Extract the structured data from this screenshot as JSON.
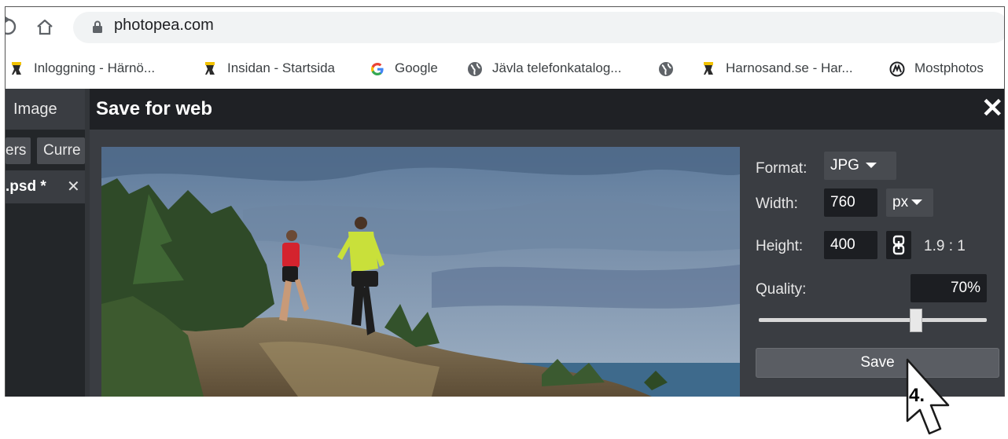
{
  "browser": {
    "url": "photopea.com",
    "bookmarks": [
      {
        "label": "Inloggning - Härnö...",
        "icon": "harnosand-logo-icon"
      },
      {
        "label": "Insidan - Startsida",
        "icon": "harnosand-logo-icon"
      },
      {
        "label": "Google",
        "icon": "google-icon"
      },
      {
        "label": "Jävla telefonkatalog...",
        "icon": "globe-icon"
      },
      {
        "label": "",
        "icon": "globe-icon"
      },
      {
        "label": "Harnosand.se - Har...",
        "icon": "harnosand-logo-icon"
      },
      {
        "label": "Mostphotos",
        "icon": "mostphotos-icon"
      }
    ]
  },
  "app": {
    "menu_image": "Image",
    "panel_buttons": [
      "ers",
      "Curre"
    ],
    "doc_tab": ".psd *",
    "doc_close": "✕"
  },
  "dialog": {
    "title": "Save for web",
    "close": "✕",
    "format_label": "Format:",
    "format_value": "JPG",
    "width_label": "Width:",
    "width_value": "760",
    "unit_value": "px",
    "height_label": "Height:",
    "height_value": "400",
    "ratio": "1.9 : 1",
    "quality_label": "Quality:",
    "quality_value": "70%",
    "quality_slider_fraction": 0.7,
    "save_label": "Save"
  },
  "annotation": {
    "step": "4."
  },
  "colors": {
    "dialog_bg": "#3a3d42",
    "titlebar_bg": "#1f2125",
    "field_bg": "#1c1e22",
    "google_blue": "#4285f4"
  }
}
